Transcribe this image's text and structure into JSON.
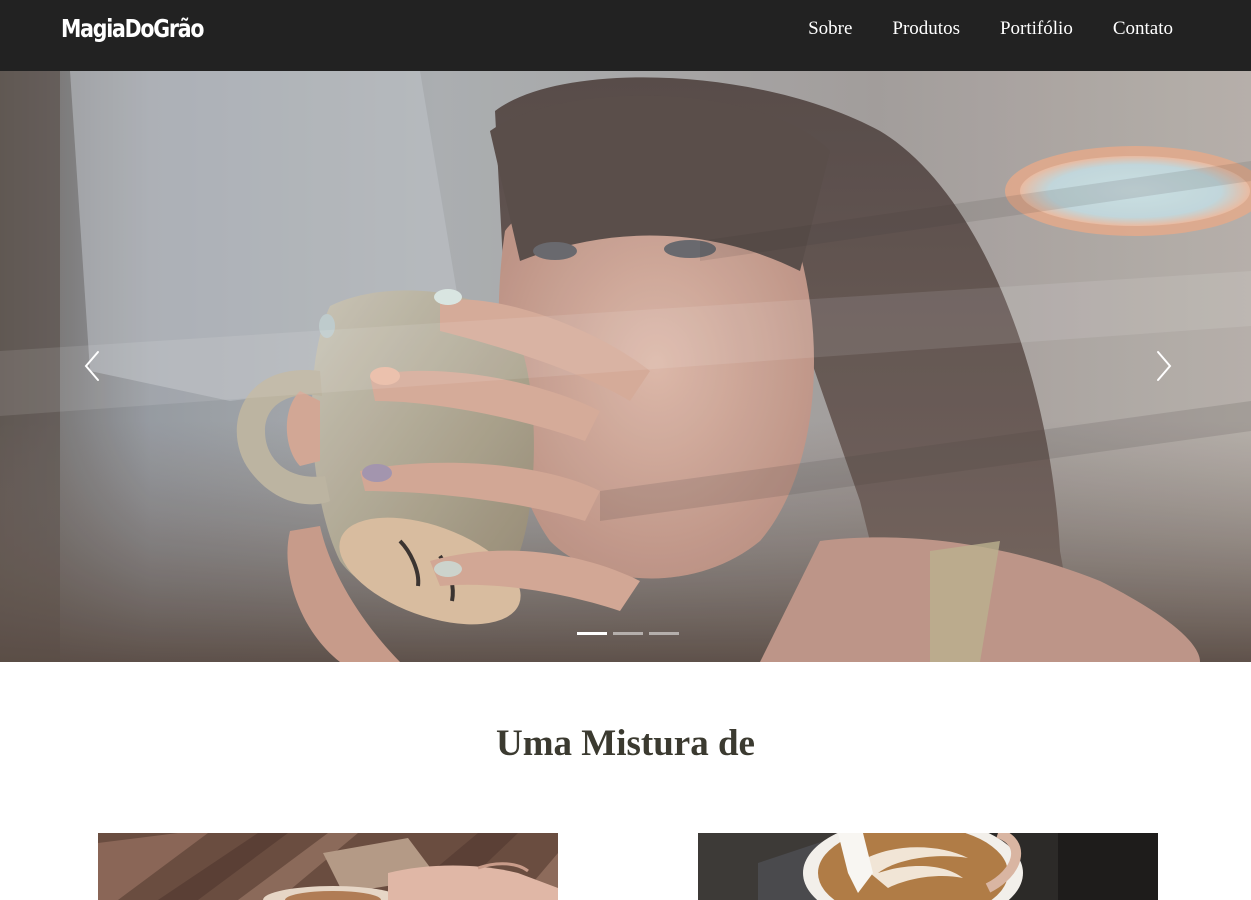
{
  "brand": {
    "name": "MagiaDoGrão"
  },
  "nav": {
    "items": [
      {
        "label": "Sobre"
      },
      {
        "label": "Produtos"
      },
      {
        "label": "Portifólio"
      },
      {
        "label": "Contato"
      }
    ]
  },
  "carousel": {
    "slide_count": 3,
    "active_slide": 1,
    "prev_icon": "chevron-left-icon",
    "next_icon": "chevron-right-icon"
  },
  "section": {
    "title": "Uma Mistura de"
  },
  "colors": {
    "navbar_bg": "#222222",
    "nav_text": "#ffffff",
    "heading_text": "#3b3a30",
    "page_bg": "#ffffff"
  }
}
